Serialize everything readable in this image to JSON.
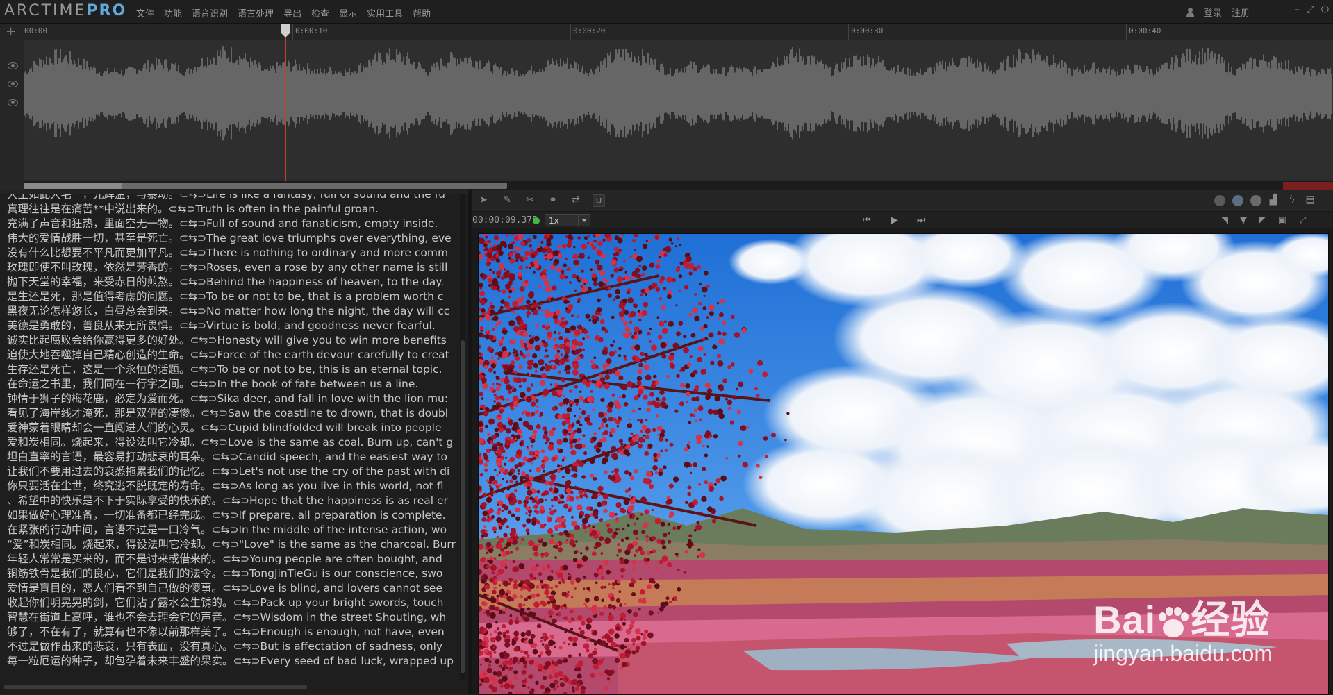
{
  "app": {
    "name": "ARCTIME",
    "edition": "PRO"
  },
  "menu": [
    "文件",
    "功能",
    "语音识别",
    "语言处理",
    "导出",
    "检查",
    "显示",
    "实用工具",
    "帮助"
  ],
  "user": {
    "login": "登录",
    "register": "注册"
  },
  "timeline": {
    "ticks": [
      "00:00",
      "0:00:10",
      "0:00:20",
      "0:00:30",
      "0:00:40"
    ]
  },
  "subtitles": [
    "大王如此大宅一，光辉温，与暴动。⊂⇆⊃Life is like a fantasy, full of sound and the fu",
    "真理往往是在痛苦**中说出来的。⊂⇆⊃Truth is often in the painful groan.",
    "充满了声音和狂热，里面空无一物。⊂⇆⊃Full of sound and fanaticism, empty inside.",
    "伟大的爱情战胜一切，甚至是死亡。⊂⇆⊃The great love triumphs over everything, eve",
    "没有什么比想要不平凡而更加平凡。⊂⇆⊃There is nothing to ordinary and more comm",
    "玫瑰即使不叫玫瑰，依然是芳香的。⊂⇆⊃Roses, even a rose by any other name is still",
    "抛下天堂的幸福，来受赤日的煎熬。⊂⇆⊃Behind the happiness of heaven, to the day.",
    "是生还是死，那是值得考虑的问题。⊂⇆⊃To be or not to be, that is a problem worth c",
    "黑夜无论怎样悠长，白昼总会到来。⊂⇆⊃No matter how long the night, the day will cc",
    "美德是勇敢的，善良从来无所畏惧。⊂⇆⊃Virtue is bold, and goodness never fearful.",
    "诚实比起腐败会给你赢得更多的好处。⊂⇆⊃Honesty will give you to win more benefits",
    "迫使大地吞噬掉自己精心创造的生命。⊂⇆⊃Force of the earth devour carefully to creat",
    "生存还是死亡，这是一个永恒的话题。⊂⇆⊃To be or not to be, this is an eternal topic.",
    "在命运之书里，我们同在一行字之间。⊂⇆⊃In the book of fate between us a line.",
    "钟情于狮子的梅花鹿，必定为爱而死。⊂⇆⊃Sika deer, and fall in love with the lion mu:",
    "看见了海岸线才淹死，那是双倍的凄惨。⊂⇆⊃Saw the coastline to drown, that is doubl",
    "爱神蒙着眼睛却会一直闯进人们的心灵。⊂⇆⊃Cupid blindfolded will break into people",
    "爱和炭相同。烧起来，得设法叫它冷却。⊂⇆⊃Love is the same as coal. Burn up, can't g",
    "坦白直率的言语，最容易打动悲哀的耳朵。⊂⇆⊃Candid speech, and the easiest way to",
    "让我们不要用过去的哀悉拖累我们的记忆。⊂⇆⊃Let's not use the cry of the past with di",
    "你只要活在尘世，终究逃不脱既定的寿命。⊂⇆⊃As long as you live in this world, not fl",
    "、希望中的快乐是不下于实际享受的快乐的。⊂⇆⊃Hope that the happiness is as real er",
    "如果做好心理准备，一切准备都已经完成。⊂⇆⊃If prepare, all preparation is complete.",
    "在紧张的行动中间，言语不过是一口冷气。⊂⇆⊃In the middle of the intense action, wo",
    "“爱”和炭相同。烧起来，得设法叫它冷却。⊂⇆⊃\"Love\" is the same as the charcoal. Burr",
    "年轻人常常是买来的，而不是讨来或借来的。⊂⇆⊃Young people are often bought, and",
    "铜筋铁骨是我们的良心，它们是我们的法令。⊂⇆⊃TongJinTieGu is our conscience, swo",
    "爱情是盲目的，恋人们看不到自己做的傻事。⊂⇆⊃Love is blind, and lovers cannot see",
    "收起你们明晃晃的剑，它们沾了露水会生锈的。⊂⇆⊃Pack up your bright swords, touch",
    "智慧在街道上高呼，谁也不会去理会它的声音。⊂⇆⊃Wisdom in the street Shouting, wh",
    "够了，不在有了，就算有也不像以前那样美了。⊂⇆⊃Enough is enough, not have, even",
    "不过是做作出来的悲哀，只有表面，没有真心。⊂⇆⊃But is affectation of sadness, only",
    "每一粒厄运的种子，却包孕着未来丰盛的果实。⊂⇆⊃Every seed of bad luck, wrapped up"
  ],
  "player": {
    "timecode": "00:00:09.375",
    "speed": "1x"
  },
  "watermark": {
    "brand": "Bai",
    "brand_tail": "经验",
    "url": "jingyan.baidu.com"
  },
  "colors": {
    "accent": "#5fa8d8",
    "playhead": "#d23a2a",
    "status_ok": "#3fb944"
  }
}
